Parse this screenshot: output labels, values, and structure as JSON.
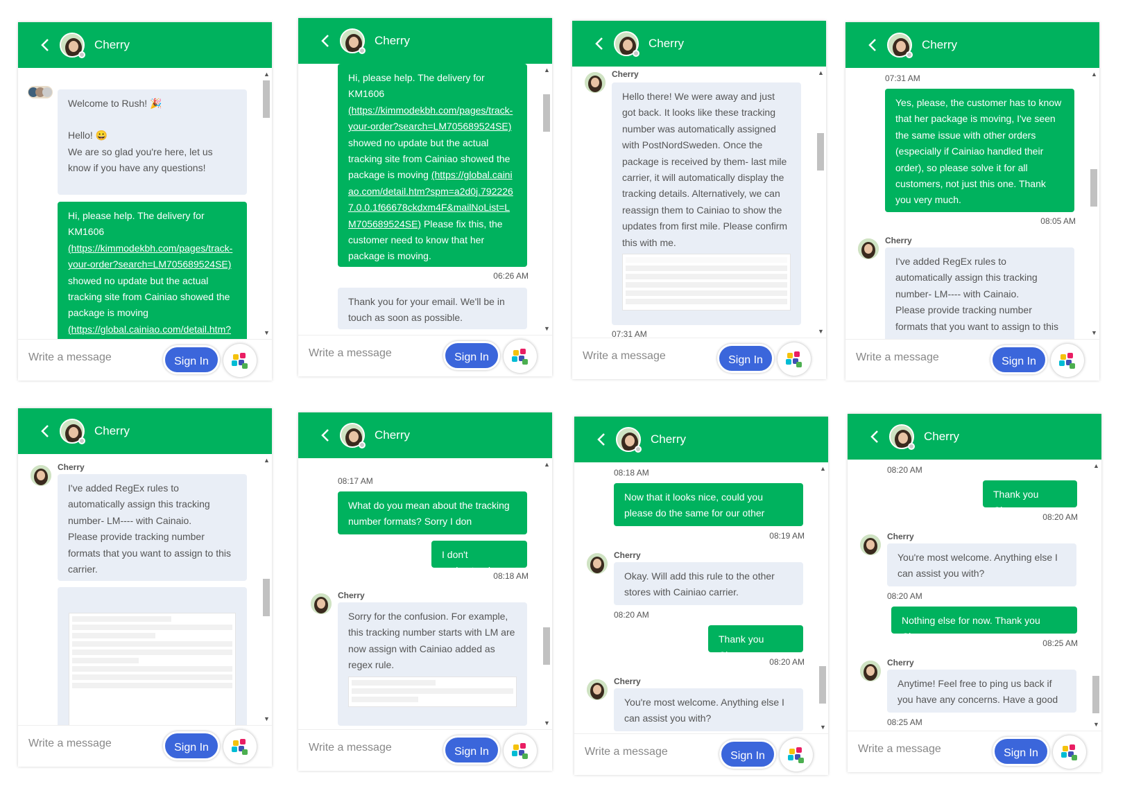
{
  "agent_name": "Cherry",
  "input_placeholder": "Write a message",
  "signin_label": "Sign In",
  "colors": {
    "header": "#00b25e",
    "user_bubble": "#00b25e",
    "bot_bubble": "#e9eef6",
    "signin": "#3b66db"
  },
  "panels": [
    {
      "messages": {
        "welcome": "Welcome to Rush! 🎉",
        "hello": "Hello! 😀",
        "glad": "We are so glad you're here, let us know if you have any questions!",
        "help_text": "Hi, please help. The delivery for KM1606 ",
        "help_link1": "(https://kimmodekbh.com/pages/track-your-order?search=LM705689524SE)",
        "help_text2": " showed no update but the actual tracking site from Cainiao showed the package is moving ",
        "help_link2": "(https://global.cainiao.com/detail.htm?"
      }
    },
    {
      "messages": {
        "help_text": "Hi, please help. The delivery for KM1606 ",
        "help_link1": "(https://kimmodekbh.com/pages/track-your-order?search=LM705689524SE)",
        "help_text2": " showed no update but the actual tracking site from Cainiao showed the package is moving ",
        "help_link2": "(https://global.cainiao.com/detail.htm?spm=a2d0j.7922267.0.0.1f66678ckdxm4F&mailNoList=LM705689524SE)",
        "help_text3": " Please fix this, the customer need to know that her package is moving.",
        "time1": "06:26 AM",
        "thanks_email": "Thank you for your email. We'll be in touch as soon as possible."
      }
    },
    {
      "messages": {
        "sender": "Cherry",
        "reply": "Hello there! We were away and just got back. It looks like these tracking number was automatically assigned with PostNordSweden. Once the package is received by them- last mile carrier, it will automatically display the tracking details. Alternatively, we can reassign them to Cainiao to show the updates from first mile. Please confirm this with me.",
        "time": "07:31 AM"
      }
    },
    {
      "messages": {
        "time0": "07:31 AM",
        "user": "Yes, please, the customer has to know that her package is moving, I've seen the same issue with other orders (especially if Cainiao handled their order), so please solve it for all customers, not just this one. Thank you very much.",
        "time1": "08:05 AM",
        "sender": "Cherry",
        "bot": "I've added RegEx rules to automatically assign this tracking number- LM---- with Cainaio.",
        "bot2": "Please provide tracking number formats that you want to assign to this carrier."
      }
    },
    {
      "messages": {
        "sender": "Cherry",
        "bot": "I've added RegEx rules to automatically assign this tracking number- LM---- with Cainaio.",
        "bot2": "Please provide tracking number formats that you want to assign to this carrier."
      }
    },
    {
      "messages": {
        "time0": "08:17 AM",
        "user1": "What do you mean about the tracking number formats? Sorry I don",
        "user2": "I don't understand",
        "time1": "08:18 AM",
        "sender": "Cherry",
        "bot": "Sorry for the confusion. For example, this tracking number starts with LM are now assign with Cainiao added as regex rule."
      }
    },
    {
      "messages": {
        "time0": "08:18 AM",
        "user1": "Now that it looks nice, could you please do the same for our other stores?",
        "time1": "08:19 AM",
        "sender": "Cherry",
        "bot1": "Okay. Will add this rule to the other stores with Cainiao carrier.",
        "time2": "08:20 AM",
        "user2": "Thank you Cherry",
        "time3": "08:20 AM",
        "bot2": "You're most welcome. Anything else I can assist you with?"
      }
    },
    {
      "messages": {
        "time0": "08:20 AM",
        "user1": "Thank you Cherry",
        "time1": "08:20 AM",
        "sender": "Cherry",
        "bot1": "You're most welcome. Anything else I can assist you with?",
        "time2": "08:20 AM",
        "user2": "Nothing else for now. Thank you Cherry",
        "time3": "08:25 AM",
        "bot2": "Anytime! Feel free to ping us back if you have any concerns. Have a good on",
        "time4": "08:25 AM"
      }
    }
  ]
}
